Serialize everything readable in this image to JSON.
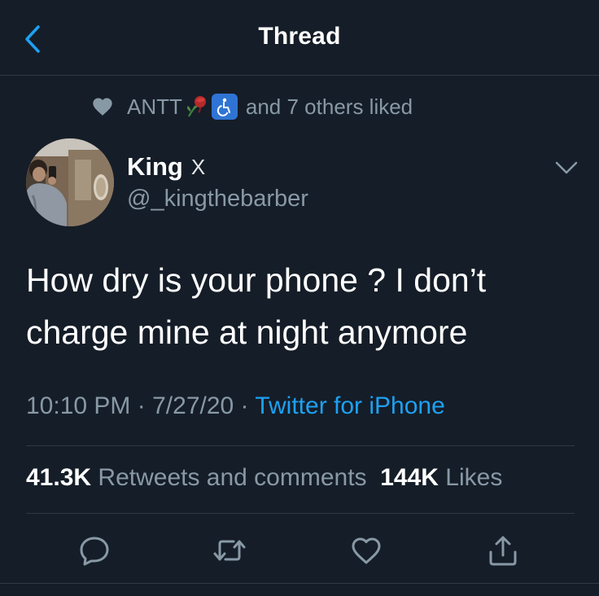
{
  "header": {
    "title": "Thread",
    "back_icon": "chevron-left-icon"
  },
  "social_context": {
    "name": "ANTT",
    "emojis": [
      "wilted-rose-emoji",
      "wheelchair-symbol-emoji"
    ],
    "suffix": "and 7 others liked",
    "icon": "heart-icon"
  },
  "author": {
    "name": "King",
    "name_suffix": "X",
    "handle": "@_kingthebarber"
  },
  "tweet": {
    "text_line1": "How dry is your phone ? I don’t",
    "text_line2": "charge mine at night anymore",
    "time": "10:10 PM",
    "separator": "·",
    "date": "7/27/20",
    "source": "Twitter for iPhone"
  },
  "stats": {
    "retweets_count": "41.3K",
    "retweets_label": "Retweets and comments",
    "likes_count": "144K",
    "likes_label": "Likes"
  },
  "actions": [
    "reply-icon",
    "retweet-icon",
    "like-icon",
    "share-icon"
  ],
  "colors": {
    "background": "#151d28",
    "secondary_text": "#8899a6",
    "link": "#1da1f2",
    "divider": "#2f3945"
  }
}
